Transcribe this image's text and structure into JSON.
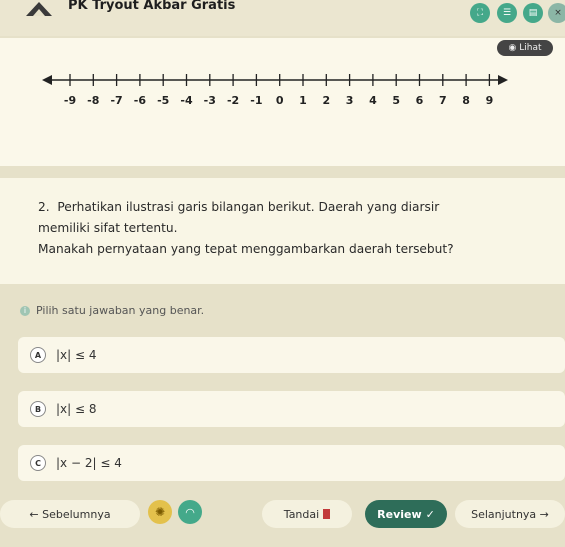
{
  "app": {
    "title": "PK Tryout Akbar Gratis"
  },
  "header_buttons": [
    {
      "icon": "fullscreen-icon"
    },
    {
      "icon": "list-icon"
    },
    {
      "icon": "document-icon"
    },
    {
      "icon": "close-icon",
      "label": "×"
    }
  ],
  "illustration": {
    "view_label": "Lihat",
    "ticks": [
      "-9",
      "-8",
      "-7",
      "-6",
      "-5",
      "-4",
      "-3",
      "-2",
      "-1",
      "0",
      "1",
      "2",
      "3",
      "4",
      "5",
      "6",
      "7",
      "8",
      "9"
    ]
  },
  "question": {
    "number": "2.",
    "line1": "Perhatikan ilustrasi garis bilangan berikut. Daerah yang diarsir",
    "line2": "memiliki sifat tertentu.",
    "line3": "Manakah pernyataan yang tepat menggambarkan daerah tersebut?"
  },
  "hint": "Pilih satu jawaban yang benar.",
  "options": [
    {
      "letter": "A",
      "text": "|x| ≤ 4"
    },
    {
      "letter": "B",
      "text": "|x| ≤ 8"
    },
    {
      "letter": "C",
      "text": "|x − 2| ≤ 4"
    }
  ],
  "footer": {
    "prev": "← Sebelumnya",
    "flag": "Tandai",
    "review": "Review",
    "next": "Selanjutnya →"
  },
  "colors": {
    "accent": "#44a98a",
    "review": "#2e6d59",
    "background": "#e6e1c9"
  }
}
